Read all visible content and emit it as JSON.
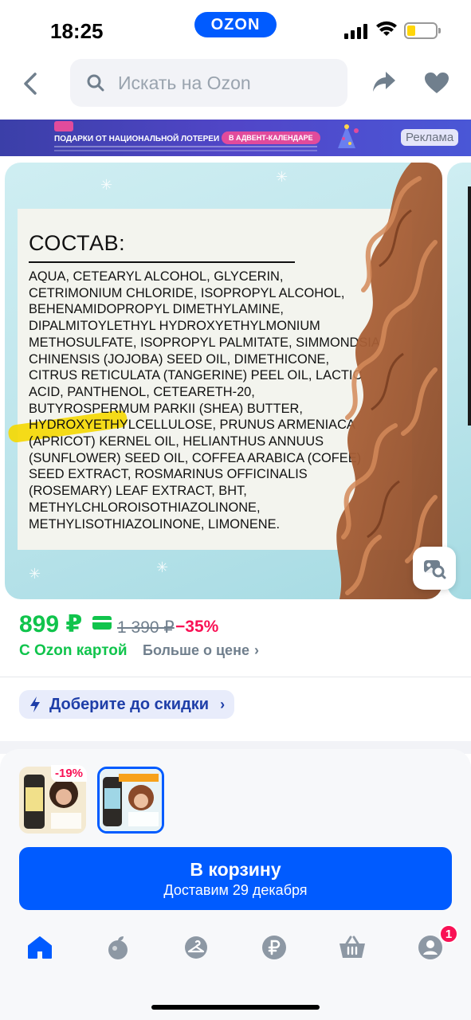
{
  "status_bar": {
    "time": "18:25",
    "brand": "OZON"
  },
  "search": {
    "placeholder": "Искать на Ozon"
  },
  "ad_banner": {
    "headline": "ПОДАРКИ ОТ НАЦИОНАЛЬНОЙ ЛОТЕРЕИ",
    "cta": "В АДВЕНТ-КАЛЕНДАРЕ",
    "label": "Реклама"
  },
  "gallery": {
    "title": "СОСТАВ:",
    "ingredients": "AQUA, CETEARYL ALCOHOL, GLYCERIN, CETRIMONIUM CHLORIDE, ISOPROPYL ALCOHOL, BEHENAMIDOPROPYL DIMETHYLAMINE, DIPALMITOYLETHYL HYDROXYETHYLMONIUM METHOSULFATE, ISOPROPYL PALMITATE, SIMMONDSIA CHINENSIS (JOJOBA) SEED OIL, DIMETHICONE, CITRUS RETICULATA (TANGERINE) PEEL OIL, LACTIC ACID, PANTHENOL, CETEARETH-20, BUTYROSPERMUM PARKII (SHEA) BUTTER, HYDROXYETHYLCELLULOSE, PRUNUS ARMENIACA (APRICOT) KERNEL OIL, HELIANTHUS ANNUUS (SUNFLOWER) SEED OIL, COFFEA ARABICA (COFEE) SEED EXTRACT, ROSMARINUS OFFICINALIS (ROSEMARY) LEAF EXTRACT, BHT, METHYLCHLOROISOTHIAZOLINONE, METHYLISOTHIAZOLINONE, LIMONENE."
  },
  "price": {
    "current": "899 ₽",
    "old": "1 390 ₽",
    "discount": "−35%",
    "with_card": "С Ozon картой",
    "more": "Больше о цене"
  },
  "promo": {
    "label": "Доберите до скидки"
  },
  "variants": [
    {
      "badge": "-19%"
    },
    {
      "badge": ""
    }
  ],
  "cart": {
    "label": "В корзину",
    "delivery": "Доставим 29 декабря"
  },
  "tabbar": {
    "items": [
      {
        "icon": "home-icon",
        "active": true
      },
      {
        "icon": "fresh-icon",
        "active": false
      },
      {
        "icon": "hanger-icon",
        "active": false
      },
      {
        "icon": "ruble-icon",
        "active": false
      },
      {
        "icon": "basket-icon",
        "active": false
      },
      {
        "icon": "profile-icon",
        "active": false
      }
    ],
    "profile_badge": "1"
  },
  "colors": {
    "accent": "#005bff",
    "price_green": "#10c44c",
    "discount_red": "#f91155"
  }
}
